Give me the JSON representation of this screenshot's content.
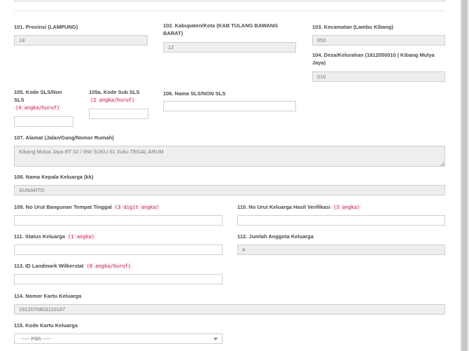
{
  "fields": {
    "f101": {
      "label": "101. Provinsi (LAMPUNG)",
      "value": "18"
    },
    "f102": {
      "label": "102. Kabupaten/Kota (KAB TULANG BAWANG BARAT)",
      "value": "12"
    },
    "f103": {
      "label": "103. Kecamatan (Lambu Kibang)",
      "value": "050"
    },
    "f104": {
      "label": "104. Desa/Kelurahan (1812050010 | Kibang Mulya Jaya)",
      "value": "010"
    },
    "f105": {
      "label": "105. Kode SLS/Non SLS",
      "hint": "(4 angka/huruf)",
      "value": ""
    },
    "f105a": {
      "label": "105a. Kode Sub SLS",
      "hint": "(2 angka/huruf)",
      "value": ""
    },
    "f106": {
      "label": "106. Nama SLS/NON SLS",
      "value": ""
    },
    "f107": {
      "label": "107. Alamat (Jalan/Gang/Nomor Rumah)",
      "value": "Kibang Mulya Jaya RT 02 / RW SUKU 01 Suku TEGAL ARUM"
    },
    "f108": {
      "label": "108. Nama Kepala Keluarga (kk)",
      "value": "SUNARTO"
    },
    "f109": {
      "label": "109. No Urut Bangunan Tempat Tinggal",
      "hint": "(3 digit angka)",
      "value": ""
    },
    "f110": {
      "label": "110. No Urut Keluarga Hasil Verifikasi",
      "hint": "(3 angka)",
      "value": ""
    },
    "f111": {
      "label": "111. Status Keluarga",
      "hint": "(1 angka)",
      "value": ""
    },
    "f112": {
      "label": "112. Jumlah Anggota Keluarga",
      "value": "4"
    },
    "f113": {
      "label": "113. ID Landmark Wilkerstat",
      "hint": "(6 angka/huruf)",
      "value": ""
    },
    "f114": {
      "label": "114. Nomor Kartu Keluarga",
      "value": "1812070803110187"
    },
    "f115": {
      "label": "115. Kode Kartu Keluarga",
      "selected": "----- Pilih -----"
    }
  }
}
